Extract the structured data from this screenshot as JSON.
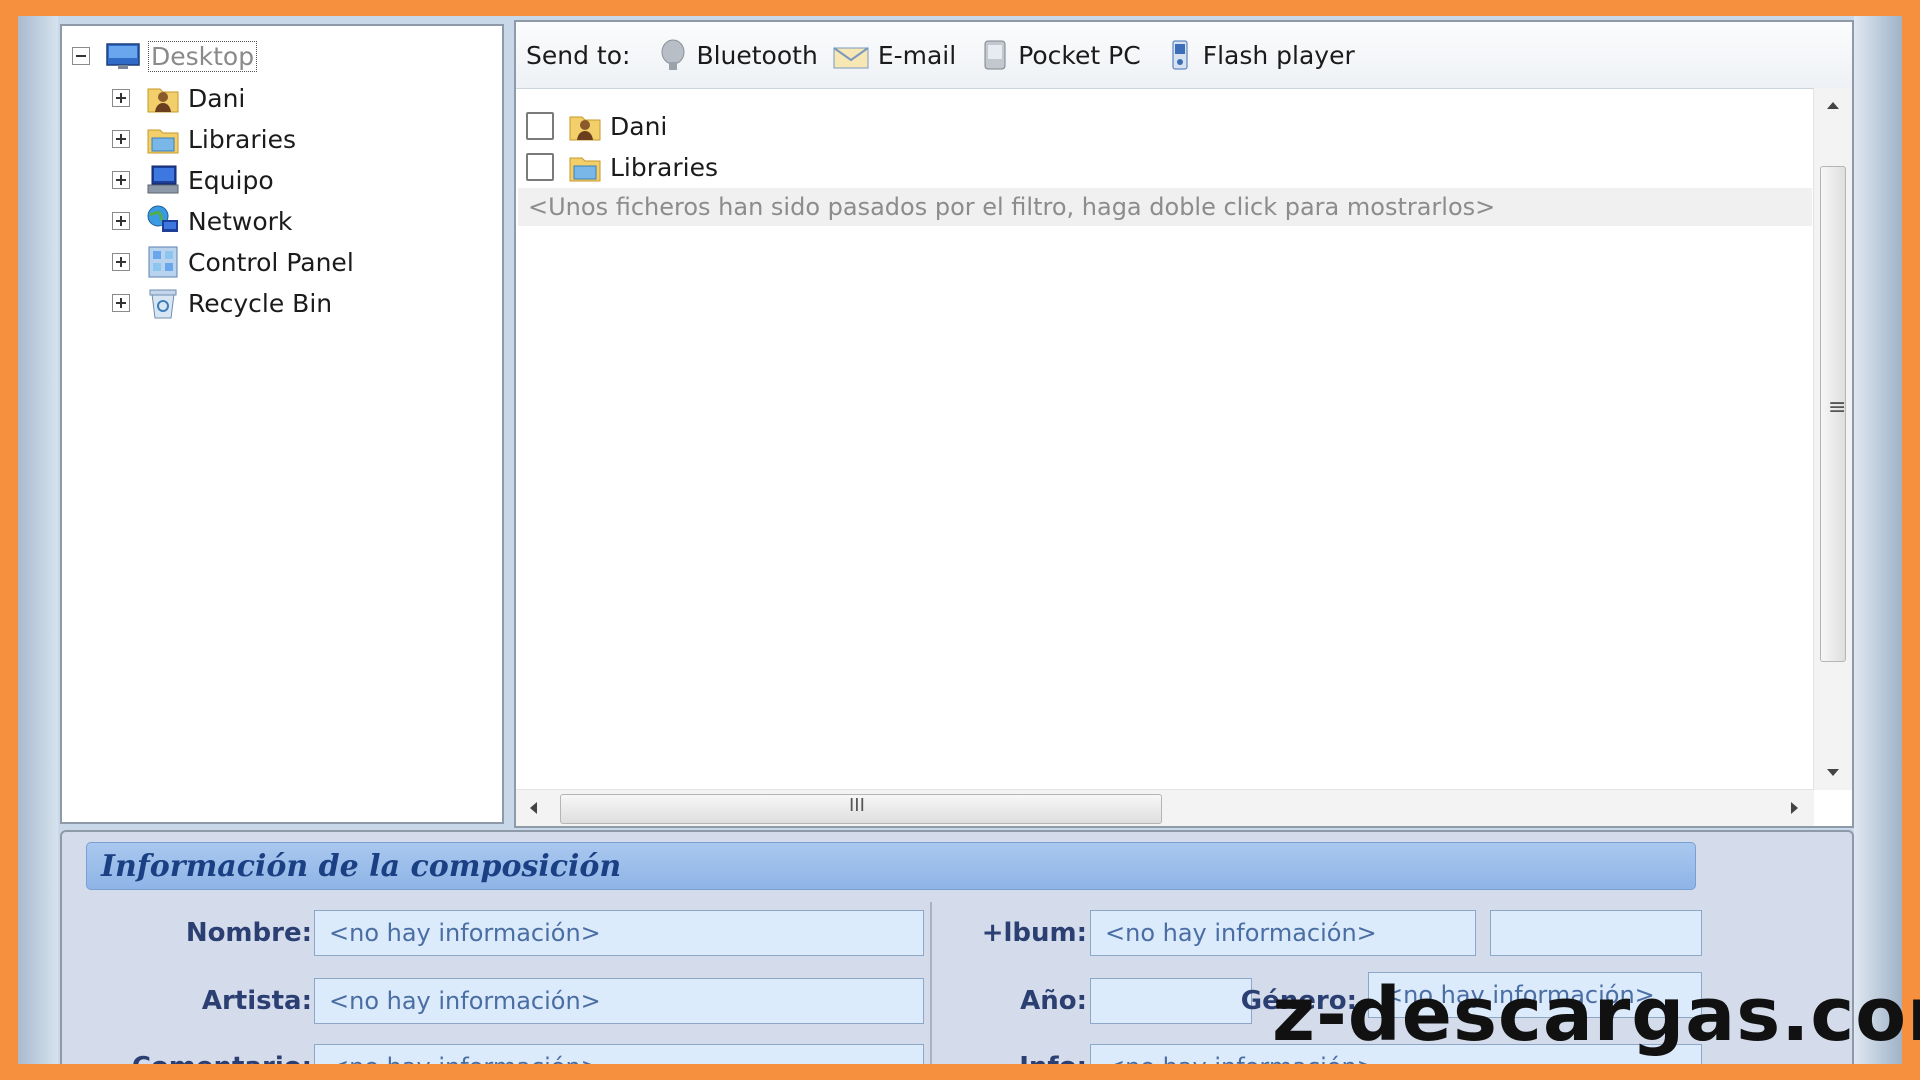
{
  "tree": {
    "root": {
      "label": "Desktop",
      "icon": "desktop-icon"
    },
    "items": [
      {
        "label": "Dani",
        "icon": "user-folder-icon"
      },
      {
        "label": "Libraries",
        "icon": "libraries-icon"
      },
      {
        "label": "Equipo",
        "icon": "computer-icon"
      },
      {
        "label": "Network",
        "icon": "network-icon"
      },
      {
        "label": "Control Panel",
        "icon": "control-panel-icon"
      },
      {
        "label": "Recycle Bin",
        "icon": "recycle-bin-icon"
      }
    ]
  },
  "sendbar": {
    "label": "Send to:",
    "targets": [
      {
        "label": "Bluetooth",
        "icon": "bluetooth-icon"
      },
      {
        "label": "E-mail",
        "icon": "email-icon"
      },
      {
        "label": "Pocket PC",
        "icon": "pocket-pc-icon"
      },
      {
        "label": "Flash player",
        "icon": "flash-player-icon"
      }
    ]
  },
  "files": {
    "rows": [
      {
        "label": "Dani",
        "icon": "user-folder-icon",
        "checked": false
      },
      {
        "label": "Libraries",
        "icon": "libraries-icon",
        "checked": false
      }
    ],
    "filter_note": "<Unos ficheros han sido pasados por el filtro, haga doble click para mostrarlos>",
    "hscroll_grip": "III",
    "vscroll_grip": "≡"
  },
  "info": {
    "title": "Información de la composición",
    "fields": {
      "nombre": {
        "label": "Nombre:",
        "value": "<no hay información>"
      },
      "artista": {
        "label": "Artista:",
        "value": "<no hay información>"
      },
      "comentario": {
        "label": "Comentario:",
        "value": "<no hay información>"
      },
      "album": {
        "label": "+lbum:",
        "value": "<no hay información>",
        "extra": ""
      },
      "anio": {
        "label": "Año:",
        "value": ""
      },
      "genero": {
        "label": "Género:",
        "value": "<no hay información>"
      },
      "info": {
        "label": "Info:",
        "value": "<no hay información>"
      }
    }
  },
  "watermark": "z-descargas.com",
  "colors": {
    "background_border": "#f7903e",
    "info_header": "#8fb4e6",
    "label_text": "#2b3f73"
  }
}
